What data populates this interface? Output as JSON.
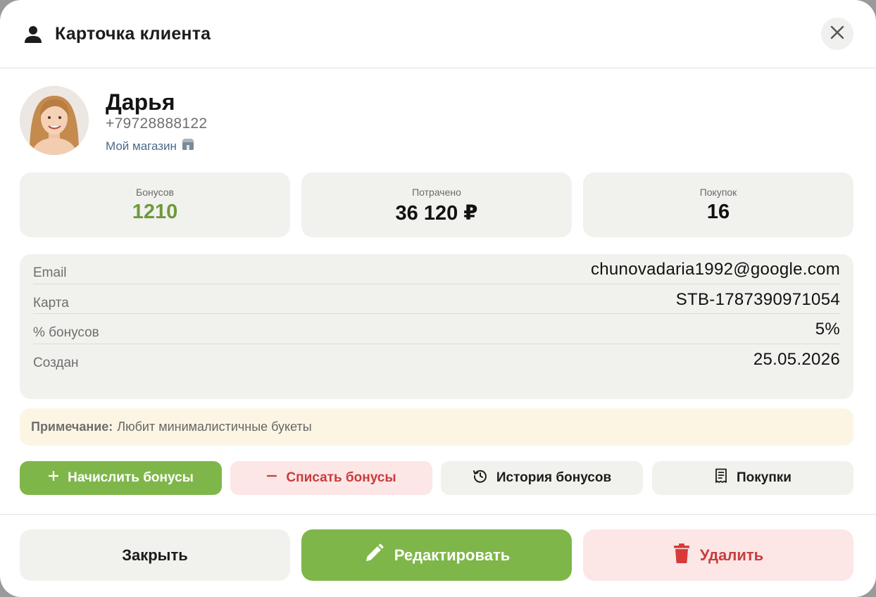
{
  "header": {
    "title": "Карточка клиента",
    "icon": "user-icon"
  },
  "client": {
    "name": "Дарья",
    "phone": "+79728888122",
    "store": "Мой магазин"
  },
  "stats": [
    {
      "label": "Бонусов",
      "value": "1210",
      "color": "#6e9a3c"
    },
    {
      "label": "Потрачено",
      "value": "36 120 ₽"
    },
    {
      "label": "Покупок",
      "value": "16"
    }
  ],
  "info": [
    {
      "label": "Email",
      "value": "chunovadaria1992@google.com"
    },
    {
      "label": "Карта",
      "value": "STB-1787390971054"
    },
    {
      "label": "% бонусов",
      "value": "5%"
    },
    {
      "label": "Создан",
      "value": "25.05.2026"
    }
  ],
  "note": {
    "label": "Примечание:",
    "text": "Любит минималистичные букеты"
  },
  "actions": {
    "add_bonus": "Начислить бонусы",
    "remove_bonus": "Списать бонусы",
    "bonus_history": "История бонусов",
    "purchases": "Покупки"
  },
  "footer": {
    "close": "Закрыть",
    "edit": "Редактировать",
    "delete": "Удалить"
  },
  "colors": {
    "accent_green": "#7fb64a",
    "danger_red": "#c93c3c",
    "danger_bg": "#fce6e6",
    "note_bg": "#fdf5e4"
  }
}
